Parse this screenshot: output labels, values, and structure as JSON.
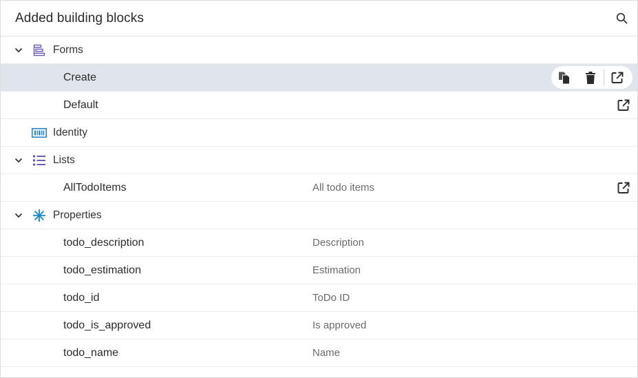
{
  "header": {
    "title": "Added building blocks",
    "search_icon": "search-icon"
  },
  "groups": {
    "forms": {
      "label": "Forms",
      "icon": "form-icon",
      "expanded": true,
      "items": [
        {
          "label": "Create",
          "description": "",
          "selected": true
        },
        {
          "label": "Default",
          "description": "",
          "selected": false
        }
      ]
    },
    "identity": {
      "label": "Identity",
      "icon": "identity-icon",
      "expanded": false
    },
    "lists": {
      "label": "Lists",
      "icon": "list-icon",
      "expanded": true,
      "items": [
        {
          "label": "AllTodoItems",
          "description": "All todo items"
        }
      ]
    },
    "properties": {
      "label": "Properties",
      "icon": "asterisk-icon",
      "expanded": true,
      "items": [
        {
          "label": "todo_description",
          "description": "Description"
        },
        {
          "label": "todo_estimation",
          "description": "Estimation"
        },
        {
          "label": "todo_id",
          "description": "ToDo ID"
        },
        {
          "label": "todo_is_approved",
          "description": "Is approved"
        },
        {
          "label": "todo_name",
          "description": "Name"
        }
      ]
    }
  },
  "colors": {
    "selected_row": "#dfe5ea",
    "form_icon": "#6e5bb8",
    "identity_icon": "#1e7fc2",
    "list_icon": "#6e5bb8",
    "properties_icon": "#1a86c9"
  }
}
